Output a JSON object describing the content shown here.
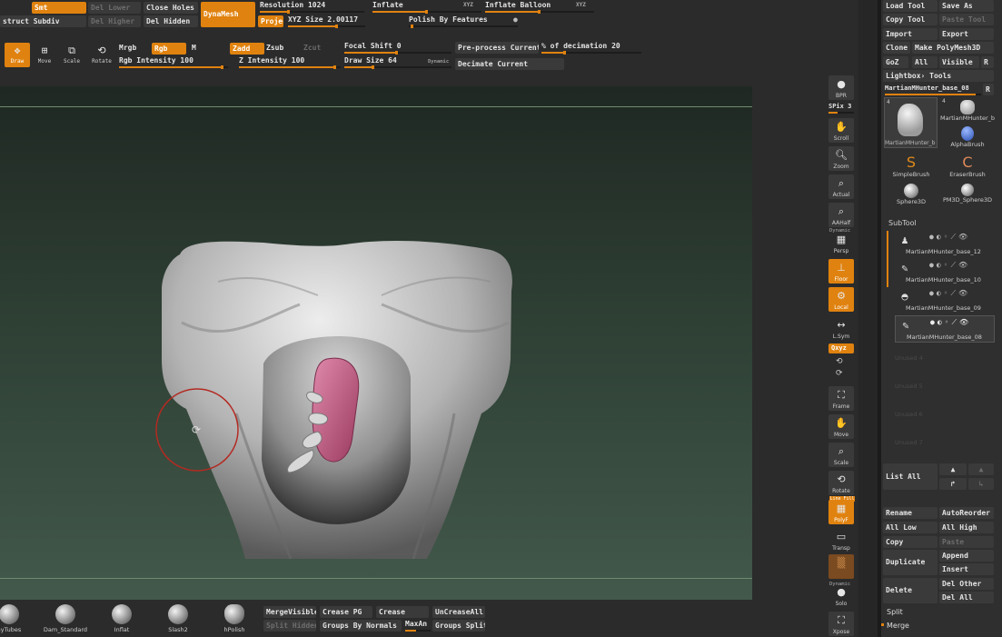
{
  "top_bar": {
    "smt": "Smt",
    "del_lower": "Del Lower",
    "close_holes": "Close Holes",
    "reconstruct_subdiv": "struct Subdiv",
    "del_higher": "Del Higher",
    "del_hidden": "Del Hidden",
    "dynamesh": "DynaMesh",
    "project": "Projec",
    "resolution": "Resolution 1024",
    "xyz_size": "XYZ Size 2.00117",
    "inflate": "Inflate",
    "inflate_xyz": "XYZ",
    "inflate_balloon": "Inflate Balloon",
    "inflate_balloon_xyz": "XYZ",
    "polish_by_features": "Polish By Features"
  },
  "draw_bar": {
    "draw": "Draw",
    "move": "Move",
    "scale": "Scale",
    "rotate": "Rotate",
    "mrgb": "Mrgb",
    "rgb": "Rgb",
    "m": "M",
    "zadd": "Zadd",
    "zsub": "Zsub",
    "zcut": "Zcut",
    "rgb_intensity": "Rgb Intensity 100",
    "z_intensity": "Z Intensity 100",
    "focal_shift": "Focal Shift 0",
    "draw_size": "Draw Size 64",
    "dynamic": "Dynamic",
    "preprocess_current": "Pre-process Current",
    "pct_of_decimation": "% of decimation 20",
    "decimate_current": "Decimate Current"
  },
  "right_toolbar": {
    "bpr": "BPR",
    "spix": "SPix 3",
    "scroll": "Scroll",
    "zoom": "Zoom",
    "actual": "Actual",
    "aahalf": "AAHalf",
    "dynamic": "Dynamic",
    "persp": "Persp",
    "floor": "Floor",
    "local": "Local",
    "lsym": "L.Sym",
    "xyz": "Qxyz",
    "frame": "Frame",
    "move": "Move",
    "scale": "Scale",
    "rotate": "Rotate",
    "linefill": "Line Fill",
    "polyf": "PolyF",
    "transp": "Transp",
    "dynamic2": "Dynamic",
    "solo": "Solo",
    "xpose": "Xpose"
  },
  "tool_panel": {
    "load_tool": "Load Tool",
    "save_as": "Save As",
    "copy_tool": "Copy Tool",
    "paste_tool": "Paste Tool",
    "import": "Import",
    "export": "Export",
    "clone": "Clone",
    "make_polymesh": "Make PolyMesh3D",
    "goz": "GoZ",
    "all": "All",
    "visible": "Visible",
    "r": "R",
    "lightbox_tools": "Lightbox› Tools",
    "current_tool": "MartianMHunter_base_08",
    "current_tool_r": "R",
    "thumb_count_a": "4",
    "thumb_count_b": "4",
    "thumbs": [
      {
        "label": "MartianMHunter_b"
      },
      {
        "label": "MartianMHunter_b"
      },
      {
        "label": "AlphaBrush"
      },
      {
        "label": "SimpleBrush"
      },
      {
        "label": "EraserBrush"
      },
      {
        "label": "Sphere3D"
      },
      {
        "label": "PM3D_Sphere3D"
      }
    ]
  },
  "subtool": {
    "title": "SubTool",
    "items": [
      {
        "name": "MartianMHunter_base_12"
      },
      {
        "name": "MartianMHunter_base_10"
      },
      {
        "name": "MartianMHunter_base_09"
      },
      {
        "name": "MartianMHunter_base_08"
      }
    ],
    "empty": [
      "Unused 4",
      "Unused 5",
      "Unused 6",
      "Unused 7"
    ],
    "list_all": "List All",
    "rename": "Rename",
    "auto_reorder": "AutoReorder",
    "all_low": "All Low",
    "all_high": "All High",
    "copy": "Copy",
    "paste": "Paste",
    "duplicate": "Duplicate",
    "append": "Append",
    "insert": "Insert",
    "delete": "Delete",
    "del_other": "Del Other",
    "del_all": "Del All",
    "split": "Split",
    "merge": "Merge"
  },
  "bottom_bar": {
    "brushes": [
      {
        "label": "ayTubes"
      },
      {
        "label": "Dam_Standard"
      },
      {
        "label": "Inflat"
      },
      {
        "label": "Slash2"
      },
      {
        "label": "hPolish"
      }
    ],
    "merge_visible": "MergeVisible",
    "crease_pg": "Crease PG",
    "crease": "Crease",
    "uncrease_all": "UnCreaseAll",
    "split_hidden": "Split Hidden",
    "groups_by_normals": "Groups By Normals",
    "maxangle": "MaxAn",
    "groups_split": "Groups Split"
  },
  "colors": {
    "accent": "#e0820f",
    "panel": "#2b2b2b",
    "button": "#3a3a3a",
    "viewport_top": "#1f2b24",
    "viewport_bottom": "#41584a",
    "model_accent": "#c4587e"
  }
}
